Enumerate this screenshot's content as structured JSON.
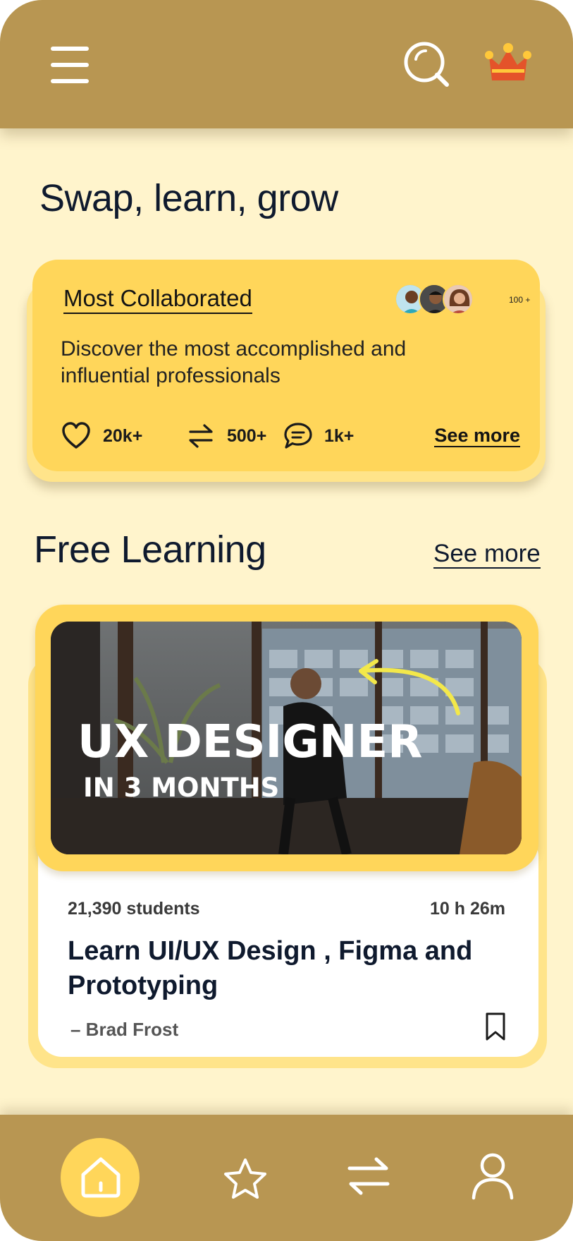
{
  "header": {
    "menu_icon": "hamburger-menu-icon",
    "search_icon": "search-icon",
    "premium_icon": "crown-icon"
  },
  "page": {
    "title": "Swap, learn, grow"
  },
  "collaborated": {
    "title": "Most Collaborated",
    "description_line1": "Discover the most accomplished and",
    "description_line2": "influential professionals",
    "avatar_count": "100 +",
    "stats": {
      "likes": "20k+",
      "swaps": "500+",
      "comments": "1k+"
    },
    "see_more": "See more"
  },
  "free_learning": {
    "title": "Free Learning",
    "see_more": "See more"
  },
  "course": {
    "thumbnail_text_line1": "UX DESIGNER",
    "thumbnail_text_line2": "IN 3 MONTHS",
    "students": "21,390 students",
    "duration": "10 h 26m",
    "title_line1": "Learn UI/UX Design , Figma  and",
    "title_line2": "Prototyping",
    "author": "–  Brad  Frost"
  },
  "nav": {
    "items": [
      "home-icon",
      "star-icon",
      "swap-icon",
      "profile-icon"
    ]
  },
  "colors": {
    "header_bg": "#b89652",
    "page_bg": "#fff4cc",
    "card_yellow": "#ffd65a",
    "card_pale": "#ffe48a",
    "text_dark": "#0f1a2e"
  }
}
